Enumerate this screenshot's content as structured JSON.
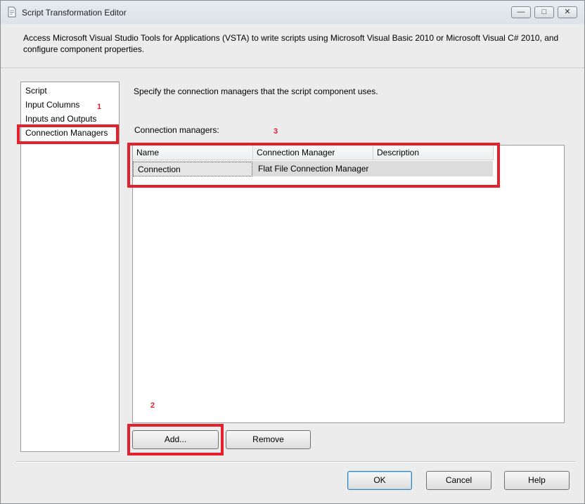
{
  "window": {
    "title": "Script Transformation Editor",
    "controls": [
      "minimize",
      "maximize",
      "close"
    ]
  },
  "description": "Access Microsoft Visual Studio Tools for Applications (VSTA) to write scripts using Microsoft Visual Basic 2010 or Microsoft Visual C# 2010, and configure component properties.",
  "sidebar": {
    "items": [
      {
        "label": "Script"
      },
      {
        "label": "Input Columns"
      },
      {
        "label": "Inputs and Outputs"
      },
      {
        "label": "Connection Managers",
        "selected": true
      }
    ]
  },
  "main": {
    "instructions": "Specify the connection managers that the script component uses.",
    "grid_label": "Connection managers:",
    "columns": [
      "Name",
      "Connection Manager",
      "Description"
    ],
    "rows": [
      {
        "name": "Connection",
        "connection_manager": "Flat File Connection Manager",
        "description": ""
      }
    ],
    "add_button": "Add...",
    "remove_button": "Remove"
  },
  "annotations": [
    "1",
    "2",
    "3"
  ],
  "footer": {
    "ok": "OK",
    "cancel": "Cancel",
    "help": "Help"
  },
  "colors": {
    "highlight_box": "#e3202c",
    "annotation_text": "#e0202e"
  }
}
